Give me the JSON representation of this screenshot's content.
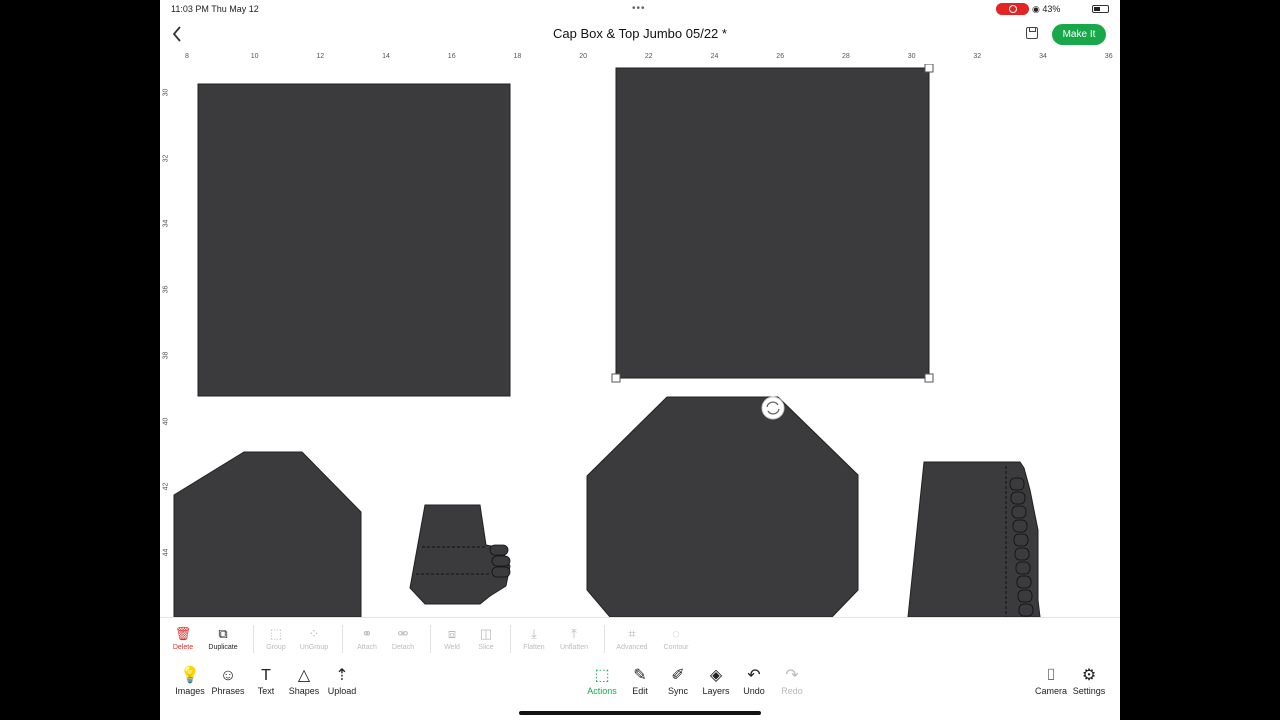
{
  "status_bar": {
    "time": "11:03 PM  Thu May 12",
    "dots": "•••",
    "right": "◉ 43%",
    "battery_level": 0.43
  },
  "header": {
    "back_icon": "chevron-left-icon",
    "title": "Cap Box & Top Jumbo 05/22 *",
    "save_icon": "save-icon",
    "make_it_label": "Make It",
    "accent_color": "#18a84a"
  },
  "rulers": {
    "top_labels": [
      "8",
      "10",
      "12",
      "14",
      "16",
      "18",
      "20",
      "22",
      "24",
      "26",
      "28",
      "30",
      "32",
      "34",
      "36"
    ],
    "left_labels": [
      "30",
      "32",
      "34",
      "36",
      "38",
      "40",
      "42",
      "44"
    ]
  },
  "canvas": {
    "shape_color": "#3b3a3c",
    "rotate_icon": "rotate-icon"
  },
  "edit_toolbar": {
    "items": [
      {
        "label": "Delete",
        "icon": "trash-icon",
        "enabled": true
      },
      {
        "label": "Duplicate",
        "icon": "duplicate-icon",
        "enabled": true
      },
      {
        "label": "Group",
        "icon": "group-icon",
        "enabled": false
      },
      {
        "label": "UnGroup",
        "icon": "ungroup-icon",
        "enabled": false
      },
      {
        "label": "Attach",
        "icon": "attach-icon",
        "enabled": false
      },
      {
        "label": "Detach",
        "icon": "detach-icon",
        "enabled": false
      },
      {
        "label": "Weld",
        "icon": "weld-icon",
        "enabled": false
      },
      {
        "label": "Slice",
        "icon": "slice-icon",
        "enabled": false
      },
      {
        "label": "Flatten",
        "icon": "flatten-icon",
        "enabled": false
      },
      {
        "label": "Unflatten",
        "icon": "unflatten-icon",
        "enabled": false
      },
      {
        "label": "Advanced",
        "icon": "advanced-icon",
        "enabled": false
      },
      {
        "label": "Contour",
        "icon": "contour-icon",
        "enabled": false
      }
    ]
  },
  "bottom_nav": {
    "left": [
      {
        "label": "Images",
        "icon": "lightbulb-icon"
      },
      {
        "label": "Phrases",
        "icon": "speech-bubble-icon"
      },
      {
        "label": "Text",
        "icon": "text-icon"
      },
      {
        "label": "Shapes",
        "icon": "shapes-icon"
      },
      {
        "label": "Upload",
        "icon": "upload-icon"
      }
    ],
    "center": [
      {
        "label": "Actions",
        "icon": "actions-icon",
        "active": true
      },
      {
        "label": "Edit",
        "icon": "edit-icon"
      },
      {
        "label": "Sync",
        "icon": "sync-icon"
      },
      {
        "label": "Layers",
        "icon": "layers-icon"
      },
      {
        "label": "Undo",
        "icon": "undo-icon"
      },
      {
        "label": "Redo",
        "icon": "redo-icon",
        "disabled": true
      }
    ],
    "right": [
      {
        "label": "Camera",
        "icon": "camera-icon"
      },
      {
        "label": "Settings",
        "icon": "gear-icon"
      }
    ]
  }
}
